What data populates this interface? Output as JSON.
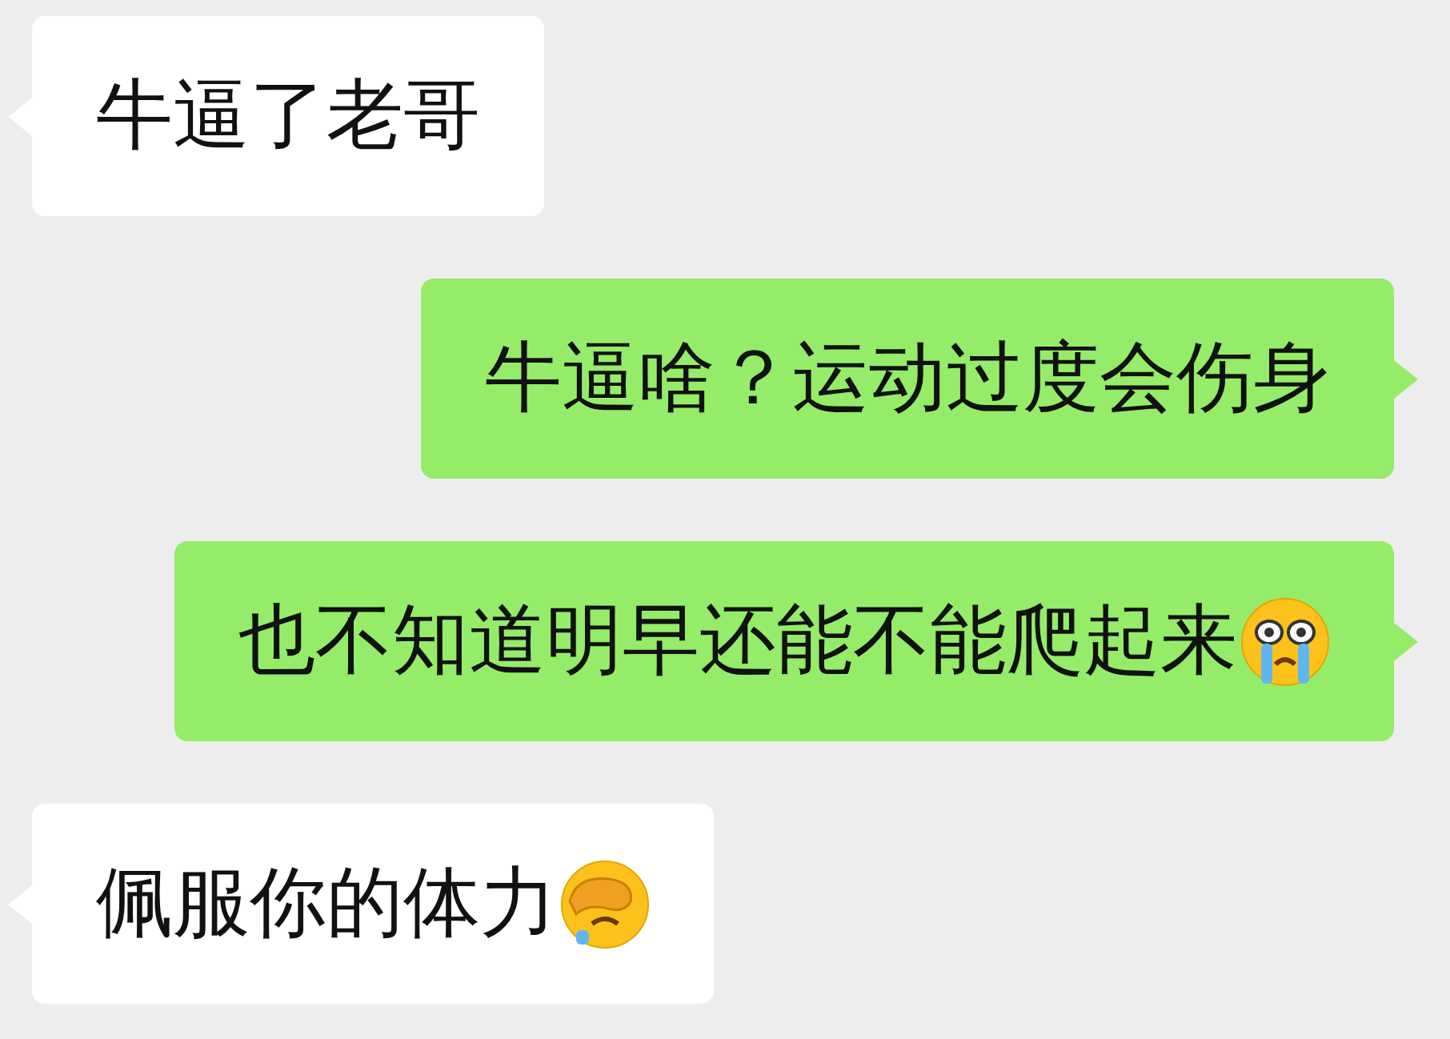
{
  "messages": [
    {
      "kind": "incoming",
      "parts": [
        {
          "kind": "text",
          "text": "牛逼了老哥"
        }
      ]
    },
    {
      "kind": "outgoing",
      "parts": [
        {
          "kind": "text",
          "text": "牛逼啥？运动过度会伤身"
        }
      ]
    },
    {
      "kind": "outgoing",
      "parts": [
        {
          "kind": "text",
          "text": "也不知道明早还能不能爬起来"
        },
        {
          "kind": "crying"
        }
      ]
    },
    {
      "kind": "incoming",
      "parts": [
        {
          "kind": "text",
          "text": "佩服你的体力"
        },
        {
          "kind": "facepalm"
        }
      ]
    }
  ]
}
